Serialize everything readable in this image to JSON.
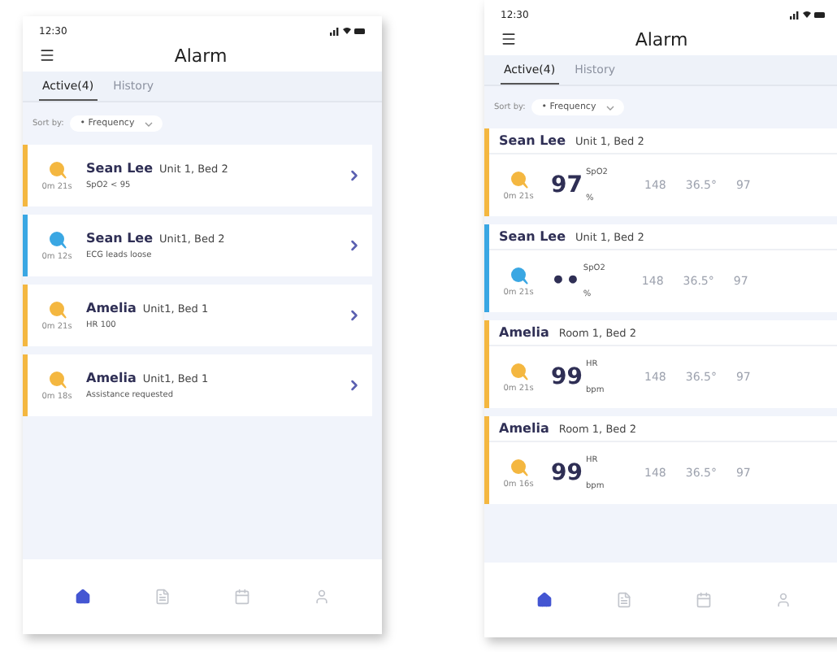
{
  "phones": [
    {
      "kind": "compact",
      "time": "12:30",
      "title": "Alarm",
      "tabs": [
        {
          "label": "Active(4)",
          "selected": true
        },
        {
          "label": "History",
          "selected": false
        }
      ],
      "sort": {
        "label": "Sort by:",
        "value": "• Frequency"
      },
      "alarms": [
        {
          "name": "Sean Lee",
          "location": "Unit 1, Bed 2",
          "duration": "0m 21s",
          "message": "SpO2 < 95",
          "color": "#f4b740"
        },
        {
          "name": "Sean Lee",
          "location": "Unit1, Bed 2",
          "duration": "0m 12s",
          "message": "ECG leads loose",
          "color": "#3aa7e3"
        },
        {
          "name": "Amelia",
          "location": "Unit1, Bed 1",
          "duration": "0m 21s",
          "message": "HR 100",
          "color": "#f4b740"
        },
        {
          "name": "Amelia",
          "location": "Unit1, Bed 1",
          "duration": "0m 18s",
          "message": "Assistance requested",
          "color": "#f4b740"
        }
      ],
      "nav": [
        {
          "kind": "home",
          "selected": true
        },
        {
          "kind": "document",
          "selected": false
        },
        {
          "kind": "calendar",
          "selected": false
        },
        {
          "kind": "profile",
          "selected": false
        }
      ]
    },
    {
      "kind": "detailed",
      "time": "12:30",
      "title": "Alarm",
      "tabs": [
        {
          "label": "Active(4)",
          "selected": true
        },
        {
          "label": "History",
          "selected": false
        }
      ],
      "sort": {
        "label": "Sort by:",
        "value": "• Frequency"
      },
      "alarms": [
        {
          "name": "Sean Lee",
          "location": "Unit 1, Bed 2",
          "duration": "0m 21s",
          "value": "97",
          "param": "SpO2",
          "unit": "%",
          "color": "#f4b740",
          "vitals": [
            "148",
            "36.5°",
            "97"
          ]
        },
        {
          "name": "Sean Lee",
          "location": "Unit 1, Bed 2",
          "duration": "0m 21s",
          "value": "••",
          "param": "SpO2",
          "unit": "%",
          "color": "#3aa7e3",
          "vitals": [
            "148",
            "36.5°",
            "97"
          ]
        },
        {
          "name": "Amelia",
          "location": "Room 1, Bed 2",
          "duration": "0m 21s",
          "value": "99",
          "param": "HR",
          "unit": "bpm",
          "color": "#f4b740",
          "vitals": [
            "148",
            "36.5°",
            "97"
          ]
        },
        {
          "name": "Amelia",
          "location": "Room 1, Bed 2",
          "duration": "0m 16s",
          "value": "99",
          "param": "HR",
          "unit": "bpm",
          "color": "#f4b740",
          "vitals": [
            "148",
            "36.5°",
            "97"
          ]
        }
      ],
      "nav": [
        {
          "kind": "home",
          "selected": true
        },
        {
          "kind": "document",
          "selected": false
        },
        {
          "kind": "calendar",
          "selected": false
        },
        {
          "kind": "profile",
          "selected": false
        }
      ]
    }
  ]
}
